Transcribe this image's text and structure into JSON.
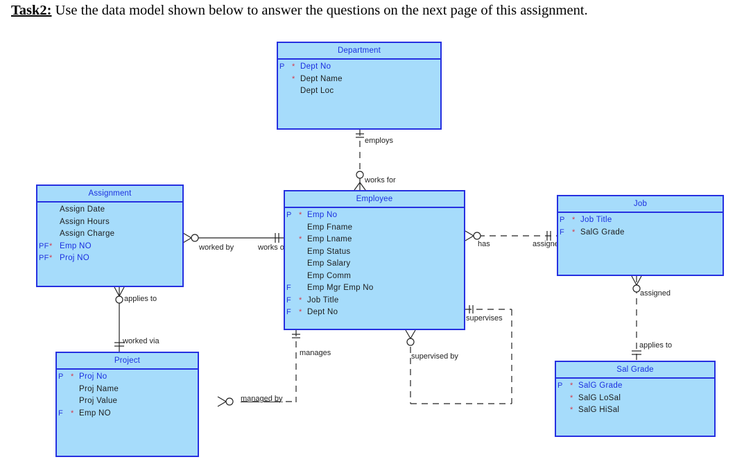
{
  "task": {
    "label": "Task2:",
    "text": " Use the data model shown below to answer the questions on the next page of this assignment."
  },
  "colors": {
    "entity_fill": "#a6dcfb",
    "entity_border": "#2630e0",
    "pk_text": "#1a2ee0",
    "required_marker": "#d43a4a"
  },
  "entities": {
    "department": {
      "name": "Department",
      "attributes": [
        {
          "key": "P",
          "required": "*",
          "name": "Dept No",
          "pk": true
        },
        {
          "key": "",
          "required": "*",
          "name": "Dept Name",
          "pk": false
        },
        {
          "key": "",
          "required": "",
          "name": "Dept Loc",
          "pk": false
        }
      ]
    },
    "employee": {
      "name": "Employee",
      "attributes": [
        {
          "key": "P",
          "required": "*",
          "name": "Emp No",
          "pk": true
        },
        {
          "key": "",
          "required": "",
          "name": "Emp Fname",
          "pk": false
        },
        {
          "key": "",
          "required": "*",
          "name": "Emp Lname",
          "pk": false
        },
        {
          "key": "",
          "required": "",
          "name": "Emp Status",
          "pk": false
        },
        {
          "key": "",
          "required": "",
          "name": "Emp Salary",
          "pk": false
        },
        {
          "key": "",
          "required": "",
          "name": "Emp Comm",
          "pk": false
        },
        {
          "key": "F",
          "required": "",
          "name": "Emp Mgr Emp No",
          "pk": false
        },
        {
          "key": "F",
          "required": "*",
          "name": "Job Title",
          "pk": false
        },
        {
          "key": "F",
          "required": "*",
          "name": "Dept No",
          "pk": false
        }
      ]
    },
    "assignment": {
      "name": "Assignment",
      "attributes": [
        {
          "key": "",
          "required": "",
          "name": "Assign Date",
          "pk": false
        },
        {
          "key": "",
          "required": "",
          "name": "Assign Hours",
          "pk": false
        },
        {
          "key": "",
          "required": "",
          "name": "Assign Charge",
          "pk": false
        },
        {
          "key": "PF",
          "required": "*",
          "name": "Emp NO",
          "pk": true
        },
        {
          "key": "PF",
          "required": "*",
          "name": "Proj NO",
          "pk": true
        }
      ]
    },
    "project": {
      "name": "Project",
      "attributes": [
        {
          "key": "P",
          "required": "*",
          "name": "Proj No",
          "pk": true
        },
        {
          "key": "",
          "required": "",
          "name": "Proj Name",
          "pk": false
        },
        {
          "key": "",
          "required": "",
          "name": "Proj Value",
          "pk": false
        },
        {
          "key": "F",
          "required": "*",
          "name": "Emp NO",
          "pk": false
        }
      ]
    },
    "job": {
      "name": "Job",
      "attributes": [
        {
          "key": "P",
          "required": "*",
          "name": "Job Title",
          "pk": true
        },
        {
          "key": "F",
          "required": "*",
          "name": "SalG Grade",
          "pk": false
        }
      ]
    },
    "salgrade": {
      "name": "Sal Grade",
      "attributes": [
        {
          "key": "P",
          "required": "*",
          "name": "SalG Grade",
          "pk": true
        },
        {
          "key": "",
          "required": "*",
          "name": "SalG LoSal",
          "pk": false
        },
        {
          "key": "",
          "required": "*",
          "name": "SalG HiSal",
          "pk": false
        }
      ]
    }
  },
  "relationships": {
    "dept_emp": {
      "from_label": "employs",
      "to_label": "works for"
    },
    "emp_assign": {
      "from_label": "works on",
      "to_label": "worked by"
    },
    "assign_proj": {
      "from_label": "applies to",
      "to_label": "worked via"
    },
    "emp_proj": {
      "from_label": "manages",
      "to_label": "managed by"
    },
    "emp_job": {
      "from_label": "has",
      "to_label": "assigned to"
    },
    "job_salgrade": {
      "from_label": "assigned",
      "to_label": "applies to"
    },
    "emp_self": {
      "from_label": "supervises",
      "to_label": "supervised by"
    }
  }
}
